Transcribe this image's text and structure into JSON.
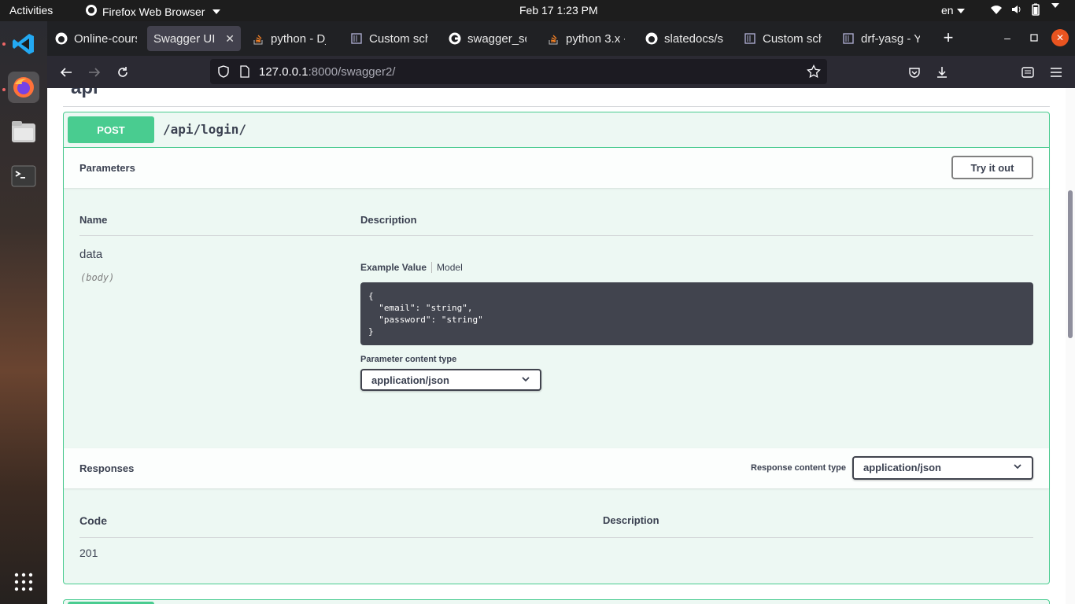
{
  "system": {
    "activities": "Activities",
    "app_name": "Firefox Web Browser",
    "clock": "Feb 17  1:23 PM",
    "language": "en"
  },
  "dock": {
    "apps": [
      "vscode-icon",
      "firefox-icon",
      "files-icon",
      "terminal-icon",
      "app-grid-icon"
    ]
  },
  "browser": {
    "tabs": [
      {
        "title": "Online-cours",
        "icon": "github-icon"
      },
      {
        "title": "Swagger UI",
        "icon": "none"
      },
      {
        "title": "python - Dja",
        "icon": "stackoverflow-icon"
      },
      {
        "title": "Custom sche",
        "icon": "docs-icon"
      },
      {
        "title": "swagger_sc",
        "icon": "google-icon"
      },
      {
        "title": "python 3.x -",
        "icon": "stackoverflow-icon"
      },
      {
        "title": "slatedocs/sl",
        "icon": "github-icon"
      },
      {
        "title": "Custom sche",
        "icon": "docs-icon"
      },
      {
        "title": "drf-yasg - Ye",
        "icon": "docs-icon"
      }
    ],
    "close_tab": "✕",
    "url_host": "127.0.0.1",
    "url_rest": ":8000/swagger2/"
  },
  "swagger": {
    "tag_heading": "api",
    "operation": {
      "method": "POST",
      "path": "/api/login/"
    },
    "parameters": {
      "title": "Parameters",
      "try_it_out": "Try it out",
      "col_name": "Name",
      "col_description": "Description",
      "param_name": "data",
      "param_in": "(body)",
      "example_tab": "Example Value",
      "model_tab": "Model",
      "example_code": "{\n  \"email\": \"string\",\n  \"password\": \"string\"\n}",
      "content_type_label": "Parameter content type",
      "content_type_value": "application/json"
    },
    "responses": {
      "title": "Responses",
      "content_type_label": "Response content type",
      "content_type_value": "application/json",
      "col_code": "Code",
      "col_description": "Description",
      "rows": [
        {
          "code": "201",
          "description": ""
        }
      ]
    }
  },
  "colors": {
    "post_green": "#49cc90",
    "post_bg": "#edf8f3",
    "code_bg": "#41444e",
    "text": "#3b4151"
  }
}
